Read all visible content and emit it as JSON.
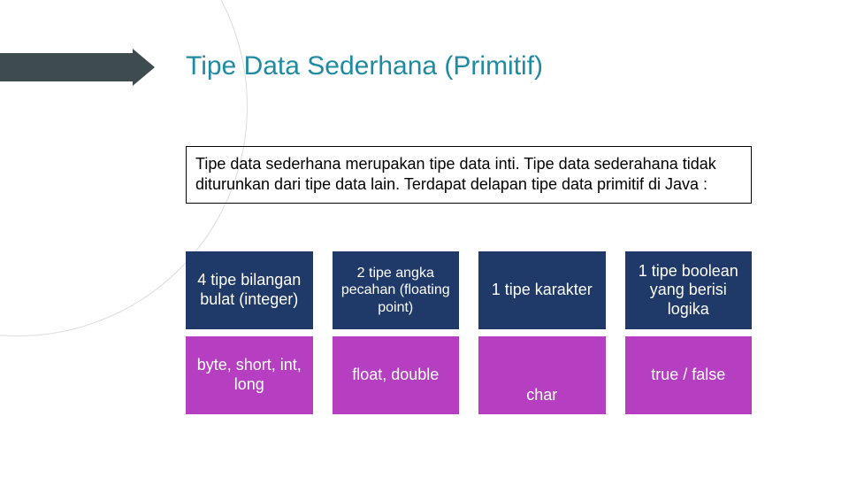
{
  "title": "Tipe Data Sederhana (Primitif)",
  "description": "Tipe data sederhana merupakan tipe data inti. Tipe data sederahana tidak diturunkan dari tipe data lain. Terdapat delapan tipe data primitif di Java :",
  "row1": {
    "c0": "4 tipe bilangan bulat (integer)",
    "c1": "2 tipe angka pecahan (floating point)",
    "c2": "1 tipe karakter",
    "c3": "1 tipe boolean yang berisi logika"
  },
  "row2": {
    "c0": "byte, short, int, long",
    "c1": "float, double",
    "c2": "char",
    "c3": "true / false"
  },
  "colors": {
    "navy": "#1f3a68",
    "purple": "#b63fc1",
    "titleTeal": "#1f8ba3"
  }
}
